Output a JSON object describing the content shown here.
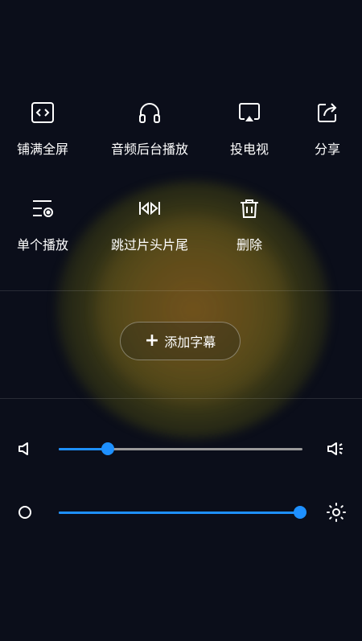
{
  "menu": {
    "row1": [
      {
        "label": "铺满全屏",
        "icon": "fullscreen-code-icon"
      },
      {
        "label": "音频后台播放",
        "icon": "headphones-icon"
      },
      {
        "label": "投电视",
        "icon": "cast-tv-icon"
      },
      {
        "label": "分享",
        "icon": "share-icon"
      }
    ],
    "row2": [
      {
        "label": "单个播放",
        "icon": "single-play-icon"
      },
      {
        "label": "跳过片头片尾",
        "icon": "skip-intro-outro-icon"
      },
      {
        "label": "删除",
        "icon": "trash-icon"
      }
    ]
  },
  "subtitle": {
    "label": "添加字幕",
    "icon": "plus-icon"
  },
  "volume": {
    "level": 0.2,
    "icon_left": "volume-low-icon",
    "icon_right": "volume-high-icon"
  },
  "brightness": {
    "level": 0.99,
    "icon_left": "brightness-low-icon",
    "icon_right": "brightness-high-icon"
  },
  "colors": {
    "accent": "#1e90ff",
    "background": "#0b0e1a",
    "track": "#9a9a9a"
  }
}
